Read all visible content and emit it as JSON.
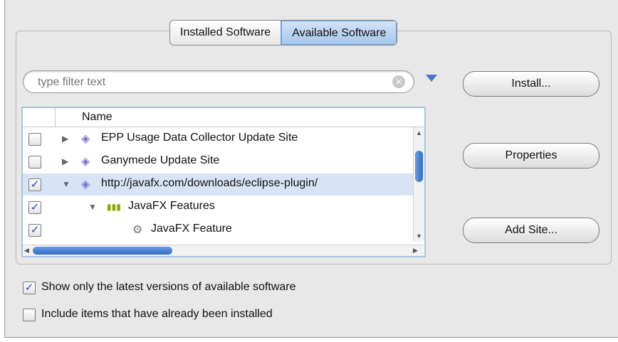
{
  "tabs": {
    "installed": "Installed Software",
    "available": "Available Software",
    "selected": "available"
  },
  "filter": {
    "placeholder": "type filter text",
    "value": ""
  },
  "buttons": {
    "install": "Install...",
    "properties": "Properties",
    "add_site": "Add Site..."
  },
  "tree": {
    "column_header": "Name",
    "rows": [
      {
        "label": "EPP Usage Data Collector Update Site",
        "checked": false,
        "expanded": false,
        "level": 0
      },
      {
        "label": "Ganymede Update Site",
        "checked": false,
        "expanded": false,
        "level": 0
      },
      {
        "label": "http://javafx.com/downloads/eclipse-plugin/",
        "checked": true,
        "expanded": true,
        "level": 0
      },
      {
        "label": "JavaFX Features",
        "checked": true,
        "expanded": true,
        "level": 1
      },
      {
        "label": "JavaFX Feature",
        "checked": true,
        "expanded": false,
        "level": 2
      }
    ]
  },
  "options": {
    "latest_only": {
      "label": "Show only the latest versions of available software",
      "checked": true
    },
    "include_installed": {
      "label": "Include items that have already been installed",
      "checked": false
    }
  },
  "colors": {
    "accent": "#4a78c8",
    "selection": "#d8e4f6"
  }
}
